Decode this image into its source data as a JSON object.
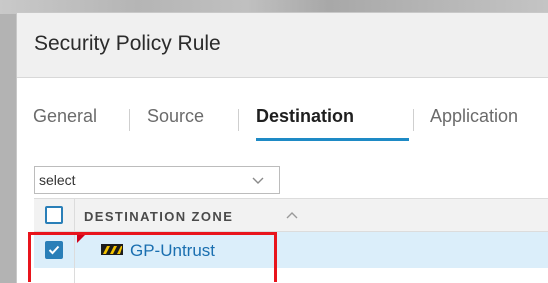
{
  "dialog": {
    "title": "Security Policy Rule"
  },
  "tabs": [
    {
      "label": "General",
      "active": false
    },
    {
      "label": "Source",
      "active": false
    },
    {
      "label": "Destination",
      "active": true
    },
    {
      "label": "Application",
      "active": false
    }
  ],
  "filter": {
    "value": "select",
    "icon": "chevron-down-icon"
  },
  "grid": {
    "header": {
      "column_label": "DESTINATION ZONE",
      "sort_icon": "chevron-up-icon",
      "select_all_checked": false
    },
    "rows": [
      {
        "name": "GP-Untrust",
        "checked": true,
        "icon": "zone-icon",
        "flag_color": "#d0021b"
      }
    ]
  },
  "colors": {
    "accent": "#1e8ac5",
    "checkbox": "#2a7fb8",
    "link": "#1a6fb0",
    "selected_row": "#dbeefa",
    "highlight": "#e8141c"
  }
}
